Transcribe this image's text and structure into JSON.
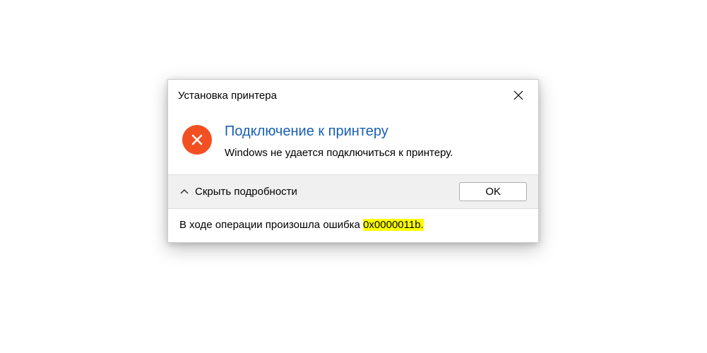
{
  "dialog": {
    "title": "Установка принтера",
    "heading": "Подключение к принтеру",
    "message": "Windows не удается подключиться к принтеру.",
    "details_toggle": "Скрыть подробности",
    "ok_label": "OK",
    "details_prefix": "В ходе операции произошла ошибка ",
    "error_code": "0x0000011b",
    "details_suffix": "."
  },
  "icons": {
    "error": "error-x-icon",
    "close": "close-icon",
    "chevron": "chevron-up-icon"
  },
  "colors": {
    "error_bg": "#f25022",
    "heading": "#1a5fb4",
    "highlight": "#ffff00",
    "footer_bg": "#f0f0f0"
  }
}
